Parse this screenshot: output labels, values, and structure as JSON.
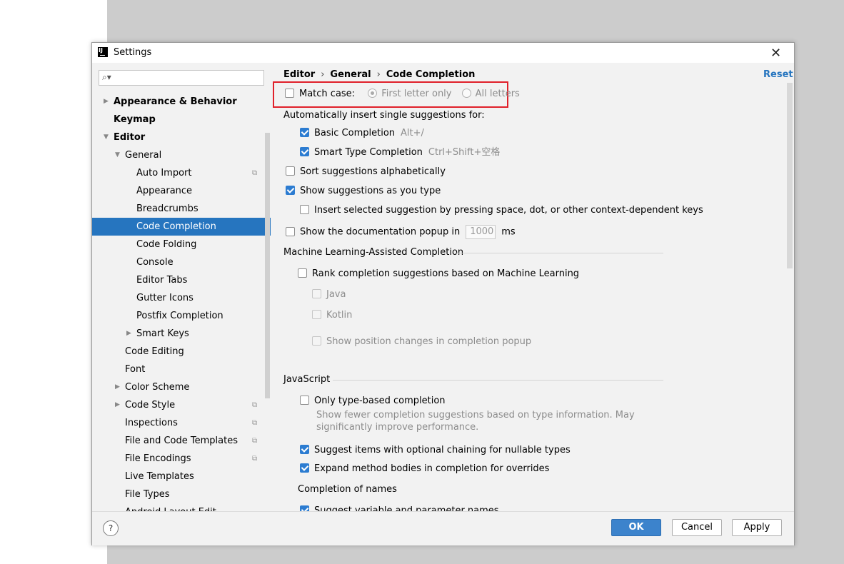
{
  "window": {
    "title": "Settings"
  },
  "search": {
    "placeholder": ""
  },
  "tree": [
    {
      "label": "Appearance & Behavior",
      "bold": true,
      "arrow": "right",
      "level": 0
    },
    {
      "label": "Keymap",
      "bold": true,
      "level": 0
    },
    {
      "label": "Editor",
      "bold": true,
      "arrow": "down",
      "level": 0
    },
    {
      "label": "General",
      "arrow": "down",
      "level": 1
    },
    {
      "label": "Auto Import",
      "level": 2,
      "copy": true
    },
    {
      "label": "Appearance",
      "level": 2
    },
    {
      "label": "Breadcrumbs",
      "level": 2
    },
    {
      "label": "Code Completion",
      "level": 2,
      "selected": true
    },
    {
      "label": "Code Folding",
      "level": 2
    },
    {
      "label": "Console",
      "level": 2
    },
    {
      "label": "Editor Tabs",
      "level": 2
    },
    {
      "label": "Gutter Icons",
      "level": 2
    },
    {
      "label": "Postfix Completion",
      "level": 2
    },
    {
      "label": "Smart Keys",
      "level": 2,
      "arrow": "right"
    },
    {
      "label": "Code Editing",
      "level": 1
    },
    {
      "label": "Font",
      "level": 1
    },
    {
      "label": "Color Scheme",
      "level": 1,
      "arrow": "right"
    },
    {
      "label": "Code Style",
      "level": 1,
      "arrow": "right",
      "copy": true
    },
    {
      "label": "Inspections",
      "level": 1,
      "copy": true
    },
    {
      "label": "File and Code Templates",
      "level": 1,
      "copy": true
    },
    {
      "label": "File Encodings",
      "level": 1,
      "copy": true
    },
    {
      "label": "Live Templates",
      "level": 1
    },
    {
      "label": "File Types",
      "level": 1
    },
    {
      "label": "Android Layout Edit...",
      "level": 1
    }
  ],
  "breadcrumb": [
    "Editor",
    "General",
    "Code Completion"
  ],
  "reset_label": "Reset",
  "match_case": {
    "label": "Match case:",
    "checked": false,
    "first_letter": "First letter only",
    "all_letters": "All letters"
  },
  "auto_insert_heading": "Automatically insert single suggestions for:",
  "basic_completion": {
    "label": "Basic Completion",
    "shortcut": "Alt+/",
    "checked": true
  },
  "smart_type": {
    "label": "Smart Type Completion",
    "shortcut": "Ctrl+Shift+空格",
    "checked": true
  },
  "sort_alpha": {
    "label": "Sort suggestions alphabetically",
    "checked": false
  },
  "show_as_type": {
    "label": "Show suggestions as you type",
    "checked": true
  },
  "insert_selected": {
    "label": "Insert selected suggestion by pressing space, dot, or other context-dependent keys",
    "checked": false
  },
  "doc_popup": {
    "label": "Show the documentation popup in",
    "value": "1000",
    "unit": "ms",
    "checked": false
  },
  "ml_section": "Machine Learning-Assisted Completion",
  "ml_rank": {
    "label": "Rank completion suggestions based on Machine Learning",
    "checked": false
  },
  "ml_java": "Java",
  "ml_kotlin": "Kotlin",
  "ml_position": "Show position changes in completion popup",
  "js_section": "JavaScript",
  "js_type_based": {
    "label": "Only type-based completion",
    "desc1": "Show fewer completion suggestions based on type information. May",
    "desc2": "significantly improve performance.",
    "checked": false
  },
  "js_optional_chaining": {
    "label": "Suggest items with optional chaining for nullable types",
    "checked": true
  },
  "js_expand_methods": {
    "label": "Expand method bodies in completion for overrides",
    "checked": true
  },
  "names_section": "Completion of names",
  "names_suggest": {
    "label": "Suggest variable and parameter names",
    "checked": true
  },
  "buttons": {
    "ok": "OK",
    "cancel": "Cancel",
    "apply": "Apply",
    "help": "?"
  },
  "colors": {
    "accent": "#2675bf",
    "highlight": "#e0202a"
  }
}
